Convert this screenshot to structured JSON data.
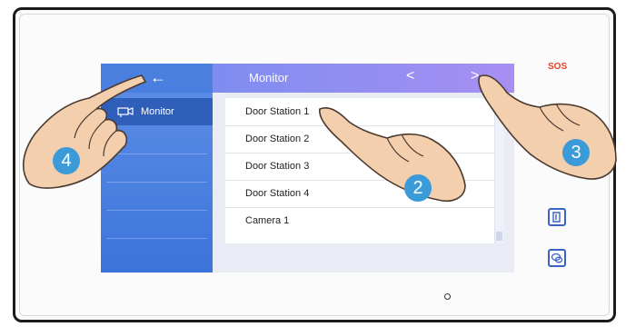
{
  "screen": {
    "header_title": "Monitor",
    "nav_prev": "<",
    "nav_next": ">",
    "back_glyph": "←",
    "sidebar_item": "Monitor",
    "list_items": [
      "Door Station 1",
      "Door Station 2",
      "Door Station 3",
      "Door Station 4",
      "Camera 1"
    ]
  },
  "device": {
    "sos_label": "SOS",
    "buttons": [
      "door-unlock-icon",
      "message-icon"
    ]
  },
  "badges": [
    "4",
    "2",
    "3"
  ],
  "colors": {
    "sidebar": "#3d74db",
    "header_start": "#7f8df0",
    "header_end": "#a78ff2",
    "badge": "#3b9bd9",
    "sos": "#e3412b",
    "button": "#3b63c7"
  }
}
